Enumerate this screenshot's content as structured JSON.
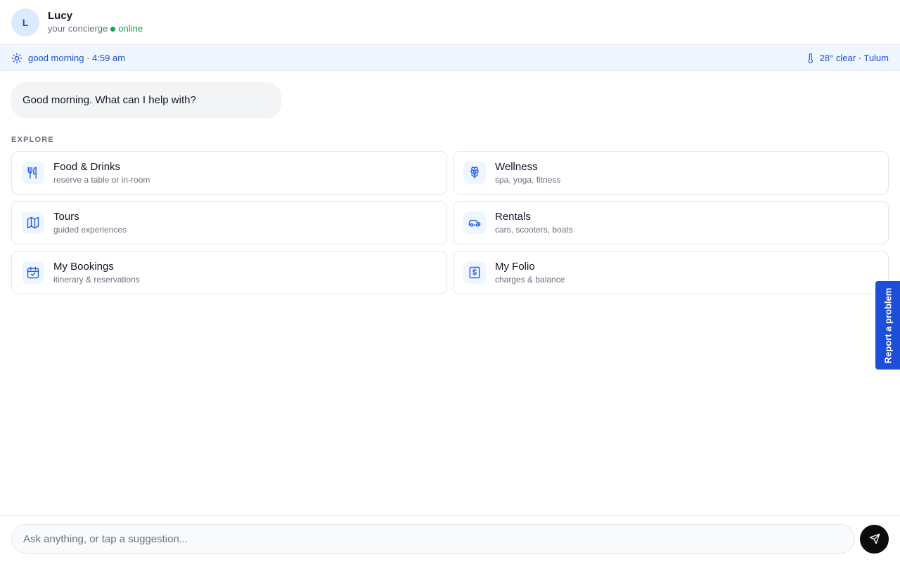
{
  "header": {
    "avatar_initial": "L",
    "name": "Lucy",
    "role": "your concierge",
    "status": "online"
  },
  "status_strip": {
    "greeting_time": "good morning · 4:59 am",
    "weather": "28° clear · Tulum",
    "left_icon": "sun-icon",
    "right_icon": "thermometer-icon"
  },
  "chat": {
    "greeting": "Good morning. What can I help with?"
  },
  "explore": {
    "label": "EXPLORE",
    "cards": [
      {
        "title": "Food & Drinks",
        "subtitle": "reserve a table or in-room",
        "icon": "utensils-icon"
      },
      {
        "title": "Wellness",
        "subtitle": "spa, yoga, fitness",
        "icon": "flower-icon"
      },
      {
        "title": "Tours",
        "subtitle": "guided experiences",
        "icon": "map-icon"
      },
      {
        "title": "Rentals",
        "subtitle": "cars, scooters, boats",
        "icon": "car-icon"
      },
      {
        "title": "My Bookings",
        "subtitle": "itinerary & reservations",
        "icon": "calendar-check-icon"
      },
      {
        "title": "My Folio",
        "subtitle": "charges & balance",
        "icon": "receipt-icon"
      }
    ]
  },
  "report_tab": {
    "label": "Report a problem"
  },
  "composer": {
    "placeholder": "Ask anything, or tap a suggestion...",
    "send_icon": "send-icon"
  },
  "colors": {
    "accent": "#1d4ed8",
    "online": "#16a34a",
    "strip_bg": "#eff6ff",
    "send_button": "#0b0b0c"
  }
}
